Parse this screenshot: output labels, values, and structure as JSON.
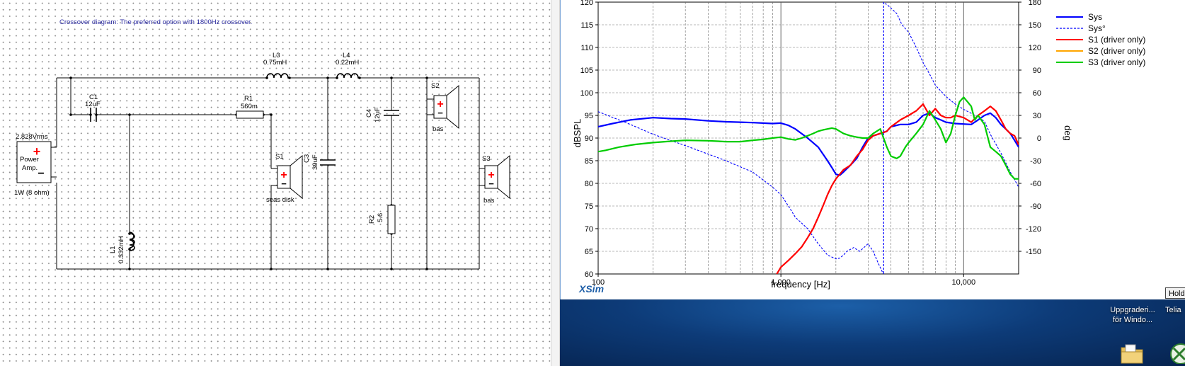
{
  "schematic": {
    "title": "Crossover diagram: The preferred option with 1800Hz crossover.",
    "amp": {
      "voltage": "2.828Vrms",
      "name_line1": "Power",
      "name_line2": "Amp.",
      "power": "1W (8 ohm)"
    },
    "components": {
      "L3": {
        "name": "L3",
        "value": "0.75mH"
      },
      "L4": {
        "name": "L4",
        "value": "0.22mH"
      },
      "C1": {
        "name": "C1",
        "value": "12uF"
      },
      "R1": {
        "name": "R1",
        "value": "560m"
      },
      "C3": {
        "name": "C3",
        "value": "39uF"
      },
      "C4": {
        "name": "C4",
        "value": "12uF"
      },
      "R2": {
        "name": "R2",
        "value": "5.6"
      },
      "L1": {
        "name": "L1",
        "value": "0.332mH"
      }
    },
    "drivers": {
      "S1": {
        "name": "S1",
        "label": "seas disk"
      },
      "S2": {
        "name": "S2",
        "label": "bas"
      },
      "S3": {
        "name": "S3",
        "label": "bas"
      }
    }
  },
  "chart_data": {
    "type": "line",
    "title": "",
    "xlabel": "frequency [Hz]",
    "ylabel": "dBSPL",
    "y2label": "deg",
    "xscale": "log",
    "xlim": [
      100,
      20000
    ],
    "ylim": [
      60,
      120
    ],
    "y2lim": [
      -180,
      180
    ],
    "xticks": [
      {
        "v": 100,
        "label": "100"
      },
      {
        "v": 1000,
        "label": "1,000"
      },
      {
        "v": 10000,
        "label": "10,000"
      }
    ],
    "yticks": [
      60,
      65,
      70,
      75,
      80,
      85,
      90,
      95,
      100,
      105,
      110,
      115,
      120
    ],
    "y2ticks": [
      -150,
      -120,
      -90,
      -60,
      -30,
      0,
      30,
      60,
      90,
      120,
      150,
      180
    ],
    "grid": true,
    "legend_position": "top-right",
    "series": [
      {
        "name": "Sys",
        "axis": "left",
        "color": "#0000ff",
        "style": "solid",
        "width": 2.2,
        "x": [
          100,
          120,
          150,
          200,
          250,
          300,
          400,
          500,
          600,
          700,
          800,
          900,
          1000,
          1100,
          1200,
          1400,
          1600,
          1800,
          1900,
          2000,
          2100,
          2200,
          2400,
          2600,
          2800,
          3000,
          3200,
          3500,
          3800,
          4000,
          4500,
          5000,
          5500,
          6000,
          6500,
          7000,
          7500,
          8000,
          9000,
          10000,
          11000,
          12000,
          13000,
          14000,
          15000,
          16000,
          17000,
          18000,
          19000,
          20000
        ],
        "y": [
          92.5,
          93.2,
          94,
          94.5,
          94.3,
          94.2,
          93.8,
          93.6,
          93.5,
          93.4,
          93.3,
          93.2,
          93.3,
          92.8,
          92,
          90,
          88,
          85,
          83.5,
          82,
          81.8,
          82.5,
          84,
          85.5,
          88,
          90,
          90.5,
          91,
          91.5,
          92.5,
          93,
          93,
          93.5,
          95,
          95.5,
          94.5,
          94,
          93.5,
          93.2,
          93.1,
          93,
          94,
          95,
          95.5,
          94.5,
          93,
          92,
          91,
          89.5,
          88
        ]
      },
      {
        "name": "Sys°",
        "axis": "right",
        "color": "#0000ff",
        "style": "dashed",
        "width": 1.1,
        "x": [
          100,
          150,
          200,
          300,
          500,
          700,
          900,
          1000,
          1100,
          1200,
          1400,
          1600,
          1800,
          2000,
          2100,
          2200,
          2300,
          2500,
          2700,
          3000,
          3200,
          3400,
          3600,
          3650,
          3700,
          3800,
          4000,
          4300,
          4600,
          5000,
          5500,
          6000,
          6500,
          7000,
          8000,
          9000,
          10000,
          12000,
          13000,
          14000,
          16000,
          18000,
          20000
        ],
        "x_break": 3650,
        "y2": [
          35,
          18,
          5,
          -10,
          -30,
          -45,
          -65,
          -75,
          -90,
          -105,
          -120,
          -140,
          -155,
          -160,
          -159,
          -155,
          -150,
          -145,
          -150,
          -140,
          -150,
          -165,
          -178,
          -180,
          178,
          177,
          172,
          165,
          150,
          140,
          120,
          100,
          85,
          70,
          55,
          45,
          38,
          28,
          22,
          5,
          -20,
          -45,
          -65
        ]
      },
      {
        "name": "S1 (driver only)",
        "axis": "left",
        "color": "#ff0000",
        "style": "solid",
        "width": 2.2,
        "x": [
          950,
          1000,
          1100,
          1200,
          1300,
          1400,
          1500,
          1600,
          1700,
          1800,
          1900,
          2000,
          2200,
          2400,
          2600,
          2800,
          3000,
          3200,
          3500,
          3800,
          4000,
          4500,
          5000,
          5500,
          6000,
          6500,
          7000,
          7500,
          8000,
          8500,
          9000,
          10000,
          11000,
          12000,
          13000,
          14000,
          15000,
          16000,
          17000,
          18000,
          19000,
          20000
        ],
        "y": [
          60,
          61.5,
          63,
          64.5,
          66,
          68,
          70,
          72.5,
          75,
          77.5,
          79.5,
          81,
          83,
          84,
          86,
          87.5,
          89.5,
          90.5,
          91,
          91.5,
          92.5,
          94,
          95,
          96,
          97.5,
          95,
          96.5,
          95,
          94.5,
          94.5,
          95,
          94.5,
          93.5,
          95,
          96,
          97,
          96,
          94,
          92,
          91,
          90.5,
          88.5
        ]
      },
      {
        "name": "S2 (driver only)",
        "axis": "left",
        "color": "#ffa500",
        "style": "solid",
        "width": 1.5,
        "x": [],
        "y": []
      },
      {
        "name": "S3 (driver only)",
        "axis": "left",
        "color": "#00cc00",
        "style": "solid",
        "width": 2.2,
        "x": [
          100,
          110,
          130,
          160,
          200,
          250,
          300,
          400,
          500,
          600,
          700,
          800,
          900,
          1000,
          1100,
          1200,
          1300,
          1400,
          1500,
          1600,
          1700,
          1800,
          1900,
          2000,
          2200,
          2400,
          2600,
          2800,
          3000,
          3200,
          3500,
          3800,
          4000,
          4300,
          4500,
          4800,
          5000,
          5500,
          6000,
          6500,
          7000,
          7500,
          8000,
          8500,
          9000,
          9500,
          10000,
          10500,
          11000,
          11500,
          12000,
          13000,
          14000,
          15000,
          16000,
          17000,
          18000,
          19000,
          20000
        ],
        "y": [
          87,
          87.3,
          88,
          88.6,
          89,
          89.3,
          89.5,
          89.4,
          89.2,
          89.2,
          89.5,
          89.7,
          90,
          90.2,
          89.8,
          89.6,
          90,
          90.5,
          91,
          91.5,
          91.8,
          92,
          92.2,
          92,
          91,
          90.5,
          90.2,
          90,
          90,
          91,
          92,
          88,
          86,
          85.5,
          86,
          88,
          89,
          91,
          93,
          96,
          94,
          92,
          89,
          91,
          95,
          98,
          99,
          98,
          97,
          94,
          95,
          93,
          88,
          87,
          86,
          84,
          82,
          81,
          81
        ]
      }
    ]
  },
  "xsim_label": "XSim",
  "hold_button": "Hold",
  "desktop": {
    "item1_line1": "Uppgraderi...",
    "item1_line2": "för Windo...",
    "item2_line1": "Telia"
  }
}
